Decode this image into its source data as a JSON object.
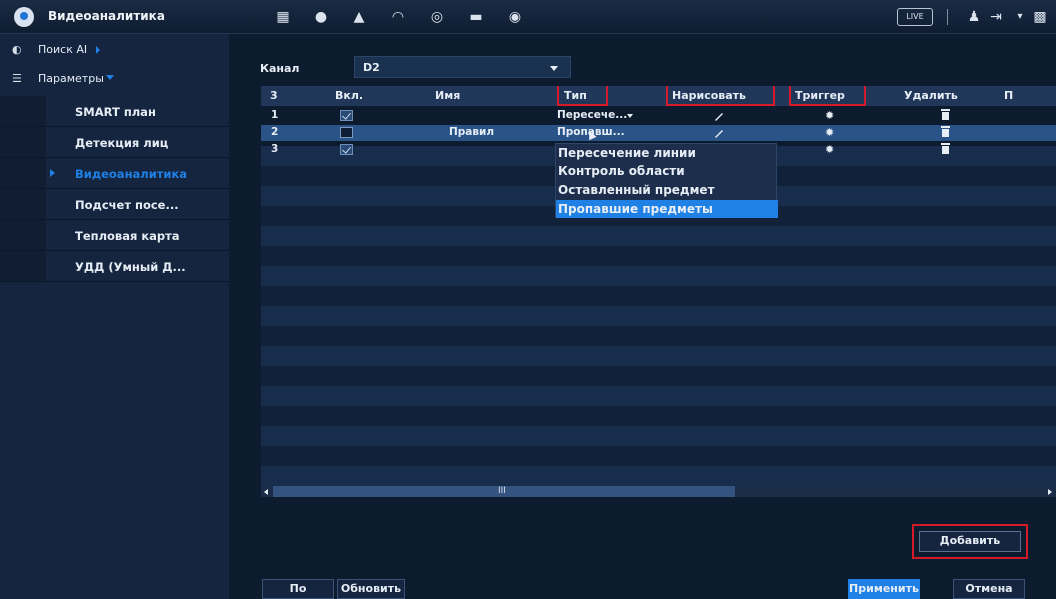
{
  "app": {
    "title": "Видеоаналитика",
    "live_label": "LIVE"
  },
  "sidebar": {
    "groups": [
      {
        "label": "Поиск AI"
      },
      {
        "label": "Параметры"
      }
    ],
    "items": [
      {
        "label": "SMART план"
      },
      {
        "label": "Детекция лиц"
      },
      {
        "label": "Видеоаналитика"
      },
      {
        "label": "Подсчет посе..."
      },
      {
        "label": "Тепловая карта"
      },
      {
        "label": "УДД (Умный Д..."
      }
    ]
  },
  "channel": {
    "label": "Канал",
    "value": "D2"
  },
  "table": {
    "headers": [
      "3",
      "Вкл.",
      "Имя",
      "Тип",
      "Нарисовать",
      "Триггер",
      "Удалить",
      "П"
    ],
    "rows": [
      {
        "num": "1",
        "enabled": true,
        "name": "",
        "type": "Пересече..."
      },
      {
        "num": "2",
        "enabled": false,
        "name": "Правил",
        "type": "Пропавш..."
      },
      {
        "num": "3",
        "enabled": true,
        "name": "",
        "type": ""
      }
    ]
  },
  "type_menu": {
    "options": [
      "Пересечение линии",
      "Контроль области",
      "Оставленный предмет",
      "Пропавшие предметы"
    ],
    "selected_index": 3
  },
  "scroll_grip": "III",
  "buttons": {
    "add": "Добавить",
    "default": "По умолч...",
    "refresh": "Обновить",
    "apply": "Применить",
    "cancel": "Отмена"
  },
  "colors": {
    "accent": "#1f80e6",
    "highlight": "#d51b2a",
    "background": "#0d1b2e"
  }
}
